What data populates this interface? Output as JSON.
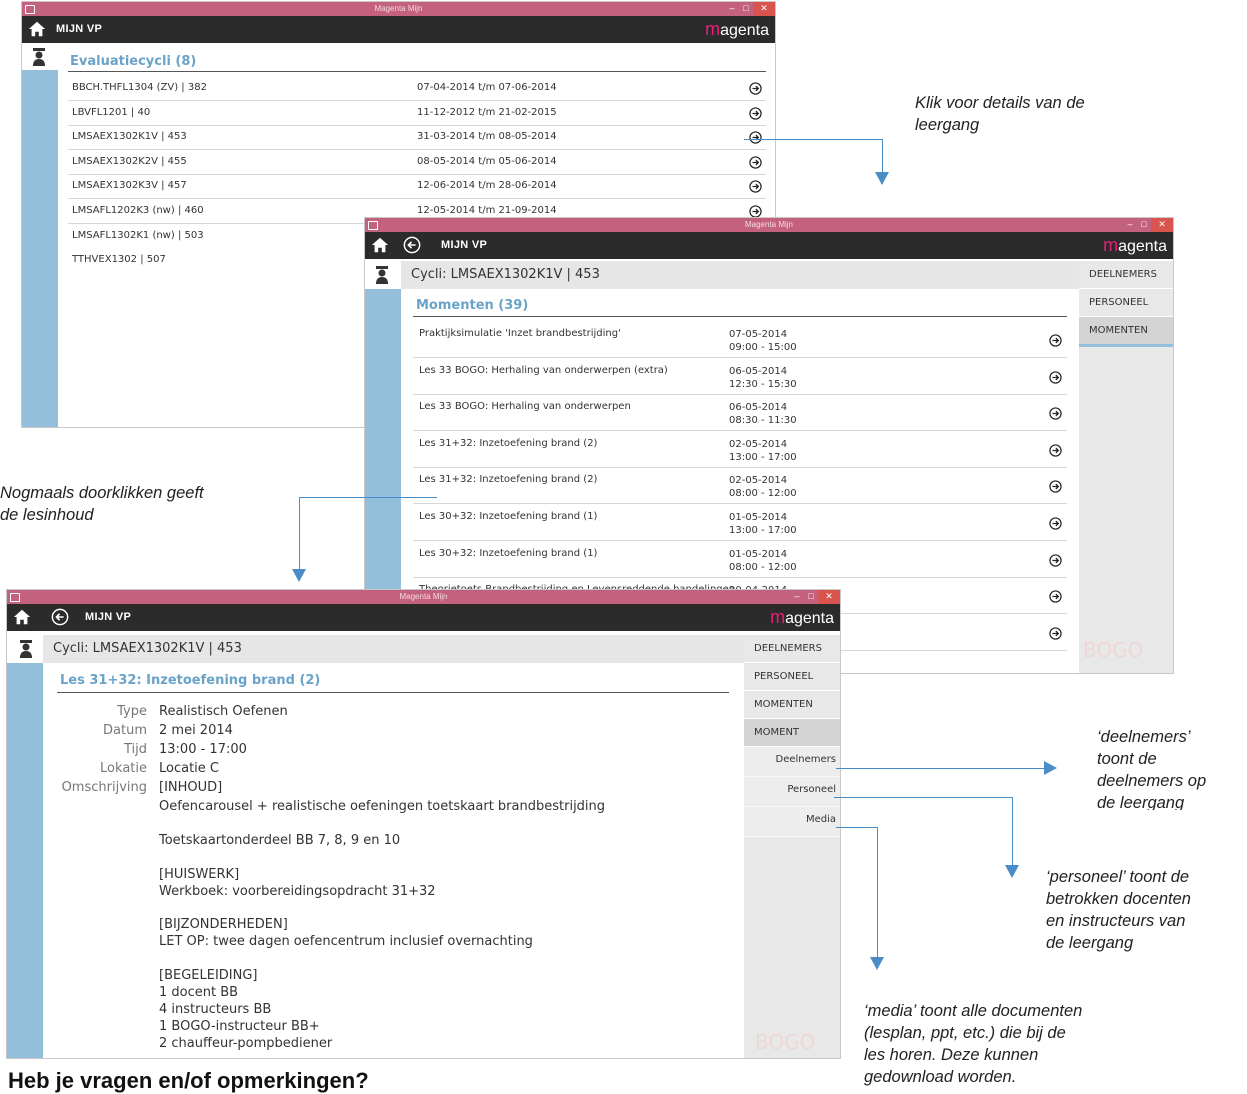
{
  "app_title": "Magenta Mijn",
  "header": {
    "label": "MIJN VP",
    "logo_m": "m",
    "logo_rest": "agenta"
  },
  "win1": {
    "section_title": "Evaluatiecycli (8)",
    "rows": [
      {
        "code": "BBCH.THFL1304 (ZV) | 382",
        "period": "07-04-2014 t/m 07-06-2014"
      },
      {
        "code": "LBVFL1201 | 40",
        "period": "11-12-2012 t/m 21-02-2015"
      },
      {
        "code": "LMSAEX1302K1V | 453",
        "period": "31-03-2014 t/m 08-05-2014"
      },
      {
        "code": "LMSAEX1302K2V | 455",
        "period": "08-05-2014 t/m 05-06-2014"
      },
      {
        "code": "LMSAEX1302K3V | 457",
        "period": "12-06-2014 t/m 28-06-2014"
      },
      {
        "code": "LMSAFL1202K3 (nw) | 460",
        "period": "12-05-2014 t/m 21-09-2014"
      },
      {
        "code": "LMSAFL1302K1 (nw) | 503",
        "period": ""
      },
      {
        "code": "TTHVEX1302 | 507",
        "period": ""
      }
    ]
  },
  "win2": {
    "cycle_title": "Cycli: LMSAEX1302K1V | 453",
    "section_title": "Momenten (39)",
    "tabs": [
      "DEELNEMERS",
      "PERSONEEL",
      "MOMENTEN"
    ],
    "rows": [
      {
        "name": "Praktijksimulatie 'Inzet brandbestrijding'",
        "date": "07-05-2014",
        "time": "09:00 - 15:00"
      },
      {
        "name": "Les 33 BOGO: Herhaling van onderwerpen (extra)",
        "date": "06-05-2014",
        "time": "12:30 - 15:30"
      },
      {
        "name": "Les 33 BOGO: Herhaling van onderwerpen",
        "date": "06-05-2014",
        "time": "08:30 - 11:30"
      },
      {
        "name": "Les 31+32: Inzetoefening brand (2)",
        "date": "02-05-2014",
        "time": "13:00 - 17:00"
      },
      {
        "name": "Les 31+32: Inzetoefening brand (2)",
        "date": "02-05-2014",
        "time": "08:00 - 12:00"
      },
      {
        "name": "Les 30+32: Inzetoefening brand (1)",
        "date": "01-05-2014",
        "time": "13:00 - 17:00"
      },
      {
        "name": "Les 30+32: Inzetoefening brand (1)",
        "date": "01-05-2014",
        "time": "08:00 - 12:00"
      },
      {
        "name": "Theorietoets Brandbestrijding en Levensreddende handelingen",
        "date": "30-04-2014",
        "time": ""
      }
    ],
    "watermark": "BOGO"
  },
  "win3": {
    "cycle_title": "Cycli: LMSAEX1302K1V | 453",
    "section_title": "Les 31+32: Inzetoefening brand (2)",
    "tabs": [
      "DEELNEMERS",
      "PERSONEEL",
      "MOMENTEN",
      "MOMENT"
    ],
    "subtabs": [
      "Deelnemers",
      "Personeel",
      "Media"
    ],
    "fields": [
      {
        "label": "Type",
        "value": "Realistisch Oefenen"
      },
      {
        "label": "Datum",
        "value": "2 mei 2014"
      },
      {
        "label": "Tijd",
        "value": "13:00 - 17:00"
      },
      {
        "label": "Lokatie",
        "value": "Locatie C"
      },
      {
        "label": "Omschrijving",
        "value": "[INHOUD]"
      }
    ],
    "description_lines": [
      "Oefencarousel + realistische oefeningen toetskaart brandbestrijding",
      "",
      "Toetskaartonderdeel BB 7, 8, 9 en 10",
      "",
      "[HUISWERK]",
      "Werkboek: voorbereidingsopdracht 31+32",
      "",
      "[BIJZONDERHEDEN]",
      "LET OP: twee dagen oefencentrum inclusief overnachting",
      "",
      "[BEGELEIDING]",
      "1 docent BB",
      "4 instructeurs BB",
      "1 BOGO-instructeur BB+",
      "2 chauffeur-pompbediener"
    ],
    "watermark": "BOGO"
  },
  "annotations": {
    "details": [
      "Klik voor details van de",
      "leergang"
    ],
    "doorklikken": [
      "Nogmaals doorklikken geeft",
      "de lesinhoud"
    ],
    "deelnemers": [
      "‘deelnemers’",
      "toont de",
      "deelnemers op",
      "de leergang"
    ],
    "personeel": [
      "‘personeel’ toont de",
      "betrokken docenten",
      "en instructeurs van",
      "de leergang"
    ],
    "media": [
      "‘media’ toont alle documenten",
      "(lesplan, ppt, etc.) die bij de",
      "les horen. Deze kunnen",
      "gedownload worden."
    ]
  },
  "bottom_heading": "Heb je vragen en/of opmerkingen?",
  "colors": {
    "titlebar": "#c4617f",
    "topbar": "#2b2b2b",
    "strip": "#94bfda",
    "accent": "#6aa3c8",
    "brand": "#e91e79",
    "connector": "#4a8cc7"
  }
}
